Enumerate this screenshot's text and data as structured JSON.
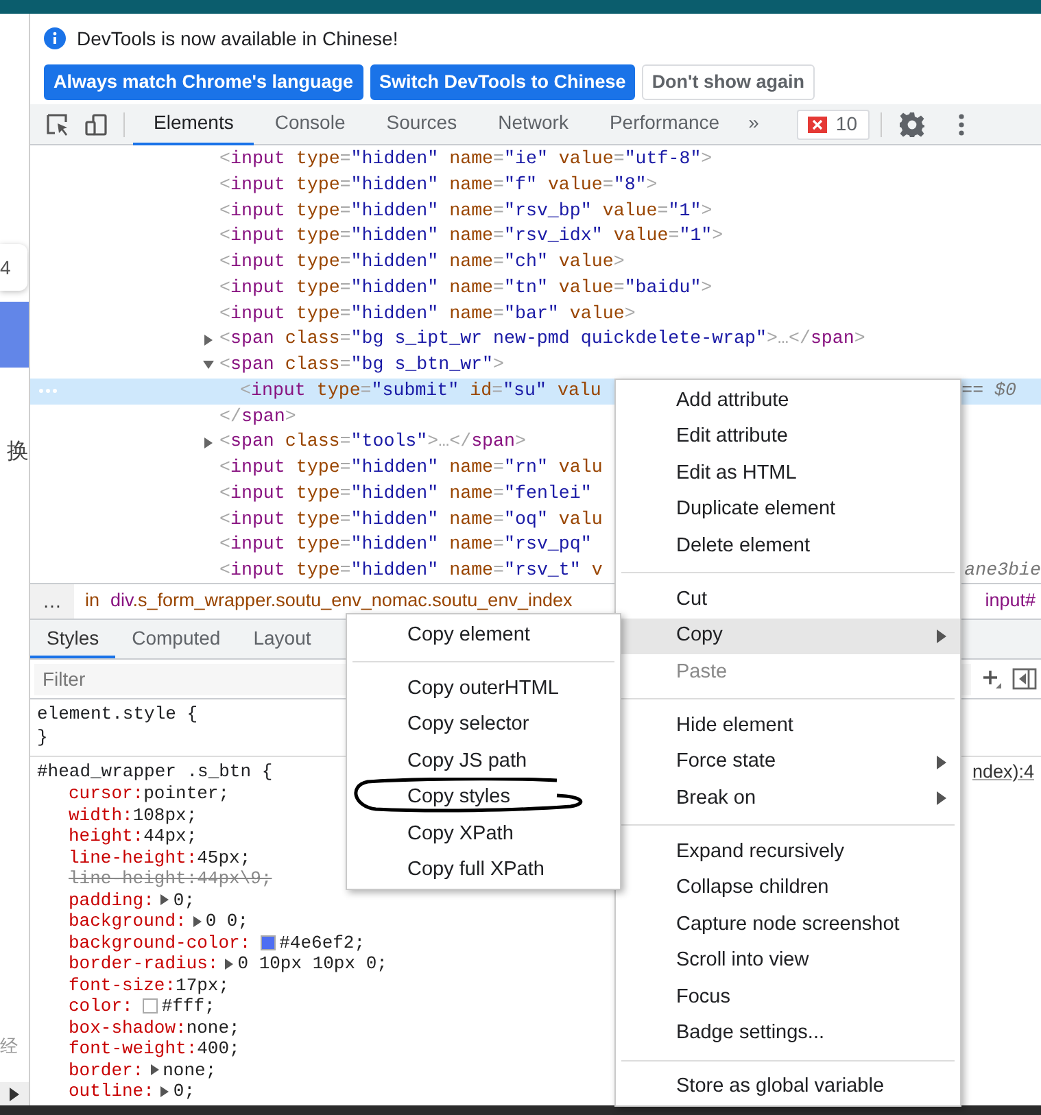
{
  "page_behind": {
    "badge": "4",
    "glyph_1": "换",
    "glyph_2": "经"
  },
  "infobar": {
    "message": "DevTools is now available in Chinese!",
    "buttons": [
      {
        "label": "Always match Chrome's language",
        "kind": "primary"
      },
      {
        "label": "Switch DevTools to Chinese",
        "kind": "primary"
      },
      {
        "label": "Don't show again",
        "kind": "secondary"
      }
    ]
  },
  "toolbar": {
    "tabs": [
      {
        "label": "Elements",
        "selected": true
      },
      {
        "label": "Console",
        "selected": false
      },
      {
        "label": "Sources",
        "selected": false
      },
      {
        "label": "Network",
        "selected": false
      },
      {
        "label": "Performance",
        "selected": false
      }
    ],
    "overflow": "»",
    "error_count": "10"
  },
  "dom_tree": {
    "lines": [
      {
        "kind": "leaf",
        "text": "<input type=\"hidden\" name=\"ie\" value=\"utf-8\">",
        "selected": false
      },
      {
        "kind": "leaf",
        "text": "<input type=\"hidden\" name=\"f\" value=\"8\">",
        "selected": false
      },
      {
        "kind": "leaf",
        "text": "<input type=\"hidden\" name=\"rsv_bp\" value=\"1\">",
        "selected": false
      },
      {
        "kind": "leaf",
        "text": "<input type=\"hidden\" name=\"rsv_idx\" value=\"1\">",
        "selected": false
      },
      {
        "kind": "leaf",
        "text": "<input type=\"hidden\" name=\"ch\" value>",
        "selected": false
      },
      {
        "kind": "leaf",
        "text": "<input type=\"hidden\" name=\"tn\" value=\"baidu\">",
        "selected": false
      },
      {
        "kind": "leaf",
        "text": "<input type=\"hidden\" name=\"bar\" value>",
        "selected": false
      },
      {
        "kind": "node",
        "expanded": false,
        "text": "<span class=\"bg s_ipt_wr new-pmd quickdelete-wrap\">…</span>",
        "selected": false
      },
      {
        "kind": "node",
        "expanded": true,
        "text": "<span class=\"bg s_btn_wr\">",
        "selected": false,
        "children": [
          {
            "kind": "leaf",
            "text": "<input type=\"submit\" id=\"su\" valu",
            "tail": "== $0",
            "selected": true
          }
        ]
      },
      {
        "kind": "leaf",
        "text": "</span>",
        "selected": false
      },
      {
        "kind": "node",
        "expanded": false,
        "text": "<span class=\"tools\">…</span>",
        "selected": false
      },
      {
        "kind": "leaf",
        "text": "<input type=\"hidden\" name=\"rn\" valu",
        "selected": false
      },
      {
        "kind": "leaf",
        "text": "<input type=\"hidden\" name=\"fenlei\"",
        "selected": false
      },
      {
        "kind": "leaf",
        "text": "<input type=\"hidden\" name=\"oq\" valu",
        "selected": false
      },
      {
        "kind": "leaf",
        "text": "<input type=\"hidden\" name=\"rsv_pq\"",
        "selected": false
      },
      {
        "kind": "leaf",
        "text": "<input type=\"hidden\" name=\"rsv_t\" v",
        "tail": "ane3bie",
        "selected": false
      }
    ]
  },
  "breadcrumbs": {
    "more": "…",
    "items": [
      "in",
      "div.s_form_wrapper.soutu_env_nomac.soutu_env_index"
    ],
    "trailing": "input#"
  },
  "styles_pane": {
    "tabs": [
      {
        "label": "Styles",
        "selected": true
      },
      {
        "label": "Computed",
        "selected": false
      },
      {
        "label": "Layout",
        "selected": false
      }
    ],
    "filter": {
      "placeholder": "Filter"
    },
    "rules": [
      {
        "header": "element.style {",
        "footer": "}"
      },
      {
        "header": "#head_wrapper .s_btn {",
        "source": "ndex):4",
        "properties": [
          {
            "name": "cursor:",
            "value": "pointer;",
            "struck": false,
            "expander": false
          },
          {
            "name": "width:",
            "value": "108px;",
            "struck": false,
            "expander": false
          },
          {
            "name": "height:",
            "value": "44px;",
            "struck": false,
            "expander": false
          },
          {
            "name": "line-height:",
            "value": "45px;",
            "struck": false,
            "expander": false
          },
          {
            "name": "line-height:",
            "value": "44px\\9;",
            "struck": true,
            "expander": false
          },
          {
            "name": "padding:",
            "value": "0;",
            "struck": false,
            "expander": true
          },
          {
            "name": "background:",
            "value": "0 0;",
            "struck": false,
            "expander": true
          },
          {
            "name": "background-color:",
            "value": "#4e6ef2;",
            "struck": false,
            "expander": false,
            "color": "#4e6ef2"
          },
          {
            "name": "border-radius:",
            "value": "0 10px 10px 0;",
            "struck": false,
            "expander": true
          },
          {
            "name": "font-size:",
            "value": "17px;",
            "struck": false,
            "expander": false
          },
          {
            "name": "color:",
            "value": "#fff;",
            "struck": false,
            "expander": false,
            "color": "#ffffff"
          },
          {
            "name": "box-shadow:",
            "value": "none;",
            "struck": false,
            "expander": false
          },
          {
            "name": "font-weight:",
            "value": "400;",
            "struck": false,
            "expander": false
          },
          {
            "name": "border:",
            "value": "none;",
            "struck": false,
            "expander": true
          },
          {
            "name": "outline:",
            "value": "0;",
            "struck": false,
            "expander": true
          }
        ]
      }
    ]
  },
  "context_menu": {
    "items": [
      {
        "kind": "item",
        "label": "Add attribute",
        "highlighted": false,
        "disabled": false,
        "submenu": false
      },
      {
        "kind": "item",
        "label": "Edit attribute",
        "highlighted": false,
        "disabled": false,
        "submenu": false
      },
      {
        "kind": "item",
        "label": "Edit as HTML",
        "highlighted": false,
        "disabled": false,
        "submenu": false
      },
      {
        "kind": "item",
        "label": "Duplicate element",
        "highlighted": false,
        "disabled": false,
        "submenu": false
      },
      {
        "kind": "item",
        "label": "Delete element",
        "highlighted": false,
        "disabled": false,
        "submenu": false
      },
      {
        "kind": "separator"
      },
      {
        "kind": "item",
        "label": "Cut",
        "highlighted": false,
        "disabled": false,
        "submenu": false
      },
      {
        "kind": "item",
        "label": "Copy",
        "highlighted": true,
        "disabled": false,
        "submenu": true
      },
      {
        "kind": "item",
        "label": "Paste",
        "highlighted": false,
        "disabled": true,
        "submenu": false
      },
      {
        "kind": "separator"
      },
      {
        "kind": "item",
        "label": "Hide element",
        "highlighted": false,
        "disabled": false,
        "submenu": false
      },
      {
        "kind": "item",
        "label": "Force state",
        "highlighted": false,
        "disabled": false,
        "submenu": true
      },
      {
        "kind": "item",
        "label": "Break on",
        "highlighted": false,
        "disabled": false,
        "submenu": true
      },
      {
        "kind": "separator"
      },
      {
        "kind": "item",
        "label": "Expand recursively",
        "highlighted": false,
        "disabled": false,
        "submenu": false
      },
      {
        "kind": "item",
        "label": "Collapse children",
        "highlighted": false,
        "disabled": false,
        "submenu": false
      },
      {
        "kind": "item",
        "label": "Capture node screenshot",
        "highlighted": false,
        "disabled": false,
        "submenu": false
      },
      {
        "kind": "item",
        "label": "Scroll into view",
        "highlighted": false,
        "disabled": false,
        "submenu": false
      },
      {
        "kind": "item",
        "label": "Focus",
        "highlighted": false,
        "disabled": false,
        "submenu": false
      },
      {
        "kind": "item",
        "label": "Badge settings...",
        "highlighted": false,
        "disabled": false,
        "submenu": false
      },
      {
        "kind": "separator"
      },
      {
        "kind": "item",
        "label": "Store as global variable",
        "highlighted": false,
        "disabled": false,
        "submenu": false
      }
    ]
  },
  "copy_submenu": {
    "items": [
      {
        "kind": "item",
        "label": "Copy element",
        "highlighted": false,
        "disabled": false,
        "submenu": false
      },
      {
        "kind": "separator"
      },
      {
        "kind": "item",
        "label": "Copy outerHTML",
        "highlighted": false,
        "disabled": false,
        "submenu": false
      },
      {
        "kind": "item",
        "label": "Copy selector",
        "highlighted": false,
        "disabled": false,
        "submenu": false
      },
      {
        "kind": "item",
        "label": "Copy JS path",
        "highlighted": false,
        "disabled": false,
        "submenu": false
      },
      {
        "kind": "item",
        "label": "Copy styles",
        "highlighted": false,
        "disabled": false,
        "submenu": false
      },
      {
        "kind": "item",
        "label": "Copy XPath",
        "highlighted": false,
        "disabled": false,
        "submenu": false
      },
      {
        "kind": "item",
        "label": "Copy full XPath",
        "highlighted": false,
        "disabled": false,
        "submenu": false
      }
    ]
  }
}
